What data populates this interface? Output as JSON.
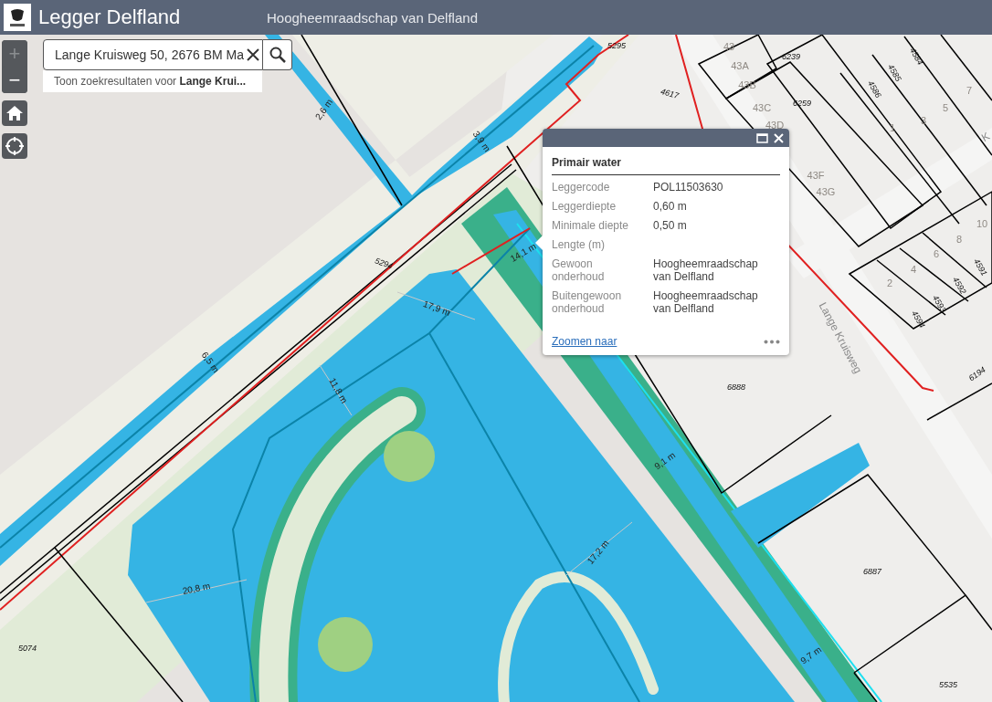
{
  "header": {
    "title": "Legger Delfland",
    "subtitle": "Hoogheemraadschap van Delfland"
  },
  "zoom": [
    {
      "label": "+",
      "disabled": true
    },
    {
      "label": "−",
      "disabled": false
    }
  ],
  "search": {
    "value": "Lange Kruisweg 50, 2676 BM Ma",
    "suggestion": "Toon zoekresultaten voor **Lange Krui...**"
  },
  "popup": {
    "title": "Primair water",
    "fields": [
      {
        "label": "Leggercode",
        "value": "POL11503630"
      },
      {
        "label": "Leggerdiepte",
        "value": "0,60 m"
      },
      {
        "label": "Minimale diepte",
        "value": "0,50 m"
      },
      {
        "label": "Lengte (m)"
      },
      {
        "label": "Gewoon onderhoud",
        "value": "Hoogheemraadschap van Delfland"
      },
      {
        "label": "Buitengewoon onderhoud",
        "value": "Hoogheemraadschap van Delfland"
      }
    ],
    "link": "Zoomen naar"
  },
  "map": {
    "labels": [
      {
        "text": "2,6 m",
        "kind": "measure"
      },
      {
        "text": "3,9 m",
        "kind": "measure"
      },
      {
        "text": "6,5 m",
        "kind": "measure"
      },
      {
        "text": "14,1 m",
        "kind": "measure"
      },
      {
        "text": "17,9 m",
        "kind": "measure"
      },
      {
        "text": "11,8 m",
        "kind": "measure"
      },
      {
        "text": "20,8 m",
        "kind": "measure"
      },
      {
        "text": "9,1 m",
        "kind": "measure"
      },
      {
        "text": "17,2 m",
        "kind": "measure"
      },
      {
        "text": "9,7 m",
        "kind": "measure"
      },
      {
        "text": "5295",
        "kind": "parcel"
      },
      {
        "text": "4617",
        "kind": "parcel"
      },
      {
        "text": "6239",
        "kind": "parcel"
      },
      {
        "text": "6259",
        "kind": "parcel"
      },
      {
        "text": "4584",
        "kind": "parcel"
      },
      {
        "text": "4585",
        "kind": "parcel"
      },
      {
        "text": "4586",
        "kind": "parcel"
      },
      {
        "text": "5294",
        "kind": "parcel"
      },
      {
        "text": "6888",
        "kind": "parcel"
      },
      {
        "text": "6887",
        "kind": "parcel"
      },
      {
        "text": "5535",
        "kind": "parcel"
      },
      {
        "text": "5074",
        "kind": "parcel"
      },
      {
        "text": "6194",
        "kind": "parcel"
      },
      {
        "text": "4591",
        "kind": "parcel"
      },
      {
        "text": "4592",
        "kind": "parcel"
      },
      {
        "text": "4593",
        "kind": "parcel"
      },
      {
        "text": "4594",
        "kind": "parcel"
      },
      {
        "text": "43",
        "kind": "house"
      },
      {
        "text": "43A",
        "kind": "house"
      },
      {
        "text": "43B",
        "kind": "house"
      },
      {
        "text": "43C",
        "kind": "house"
      },
      {
        "text": "43D",
        "kind": "house"
      },
      {
        "text": "43F",
        "kind": "house"
      },
      {
        "text": "43G",
        "kind": "house"
      },
      {
        "text": "1",
        "kind": "house"
      },
      {
        "text": "3",
        "kind": "house"
      },
      {
        "text": "5",
        "kind": "house"
      },
      {
        "text": "7",
        "kind": "house"
      },
      {
        "text": "10",
        "kind": "house"
      },
      {
        "text": "8",
        "kind": "house"
      },
      {
        "text": "6",
        "kind": "house"
      },
      {
        "text": "4",
        "kind": "house"
      },
      {
        "text": "2",
        "kind": "house"
      },
      {
        "text": "Lange Kruisweg",
        "kind": "street"
      },
      {
        "text": "K",
        "kind": "street"
      }
    ]
  }
}
